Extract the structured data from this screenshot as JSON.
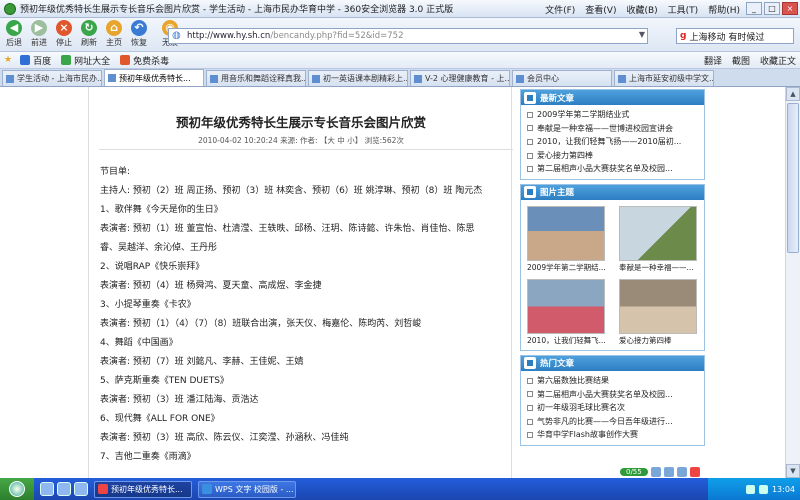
{
  "window": {
    "title": "预初年级优秀特长生展示专长音乐会图片欣赏 - 学生活动 - 上海市民办华育中学 - 360安全浏览器 3.0 正式版",
    "menu": [
      "文件(F)",
      "查看(V)",
      "收藏(B)",
      "工具(T)",
      "帮助(H)"
    ]
  },
  "toolbar": {
    "buttons": [
      {
        "label": "后退",
        "icon": "back-arrow-icon",
        "color": "#3aa64a"
      },
      {
        "label": "前进",
        "icon": "forward-arrow-icon",
        "color": "#9bbf9f"
      },
      {
        "label": "停止",
        "icon": "stop-icon",
        "color": "#e0572b"
      },
      {
        "label": "刷新",
        "icon": "refresh-icon",
        "color": "#3aa64a"
      },
      {
        "label": "主页",
        "icon": "home-icon",
        "color": "#e8a52e"
      },
      {
        "label": "恢复",
        "icon": "restore-icon",
        "color": "#3a7bd5"
      },
      {
        "label": "无痕",
        "icon": "incognito-icon",
        "color": "#e8a52e"
      }
    ],
    "address_host": "http://www.hy.sh.cn",
    "address_path": "/bencandy.php?fid=52&id=752",
    "search_text": "上海移动 有时候过"
  },
  "favbar": {
    "items": [
      {
        "label": "百度",
        "color": "#2f6fd6"
      },
      {
        "label": "网址大全",
        "color": "#3aa64a"
      },
      {
        "label": "免费杀毒",
        "color": "#e0572b"
      }
    ],
    "right": [
      "翻译",
      "截图",
      "收藏正文"
    ]
  },
  "tabs": [
    {
      "label": "学生活动 - 上海市民办...",
      "active": false
    },
    {
      "label": "预初年级优秀特长...",
      "active": true
    },
    {
      "label": "用音乐和舞蹈诠释真我...",
      "active": false
    },
    {
      "label": "初一英语课本剧精彩上...",
      "active": false
    },
    {
      "label": "V-2 心理健康教育 - 上...",
      "active": false
    },
    {
      "label": "会员中心",
      "active": false
    },
    {
      "label": "上海市延安初级中学文...",
      "active": false
    }
  ],
  "article": {
    "title": "预初年级优秀特长生展示专长音乐会图片欣赏",
    "meta": "2010-04-02 10:20:24 来源: 作者: 【大 中 小】 浏览:562次",
    "lines": [
      "节目单:",
      "主持人: 预初（2）班 周正扬、预初（3）班 林奕含、预初（6）班 姚淳琳、预初（8）班 陶元杰",
      "1、歌伴舞《今天是你的生日》",
      "表演者: 预初（1）班 董宣怡、杜清滢、王轶昳、邱杨、汪玥、陈诗懿、许朱怡、肖佳怡、陈思",
      "睿、吴越洋、余沁倬、王丹彤",
      "2、说唱RAP《快乐崇拜》",
      "表演者: 预初（4）班 杨舜鸿、夏天童、高成煜、李金捷",
      "3、小提琴重奏《卡农》",
      "表演者: 预初（1）（4）（7）（8）班联合出演，张天仪、梅嘉伦、陈昀芮、刘哲峻",
      "4、舞蹈《中国画》",
      "表演者: 预初（7）班 刘懿凡、李赫、王佳妮、王婧",
      "5、萨克斯重奏《TEN DUETS》",
      "表演者: 预初（3）班 潘江陆海、贡浩达",
      "6、现代舞《ALL FOR ONE》",
      "表演者: 预初（3）班 高欣、陈云仪、江奕滢、孙涵秋、冯佳纯",
      "7、吉他二重奏《雨滴》"
    ]
  },
  "sidebar": {
    "latest": {
      "header": "最新文章",
      "items": [
        "2009学年第二学期结业式",
        "奉献是一种幸福——世博进校园宣讲会",
        "2010，让我们轻舞飞扬——2010届初...",
        "爱心接力第四棒",
        "第二届相声小品大赛获奖名单及校园..."
      ]
    },
    "pictures": {
      "header": "图片主题",
      "items": [
        {
          "caption": "2009学年第二学期结...",
          "c1": "#6a8fb8",
          "c2": "#c9a889"
        },
        {
          "caption": "奉献是一种幸福——...",
          "c1": "#c8d6e0",
          "c2": "#6c8a4a"
        },
        {
          "caption": "2010，让我们轻舞飞...",
          "c1": "#8aa6c0",
          "c2": "#d15b6a"
        },
        {
          "caption": "爱心接力第四棒",
          "c1": "#9a8a78",
          "c2": "#d6c3ac"
        }
      ]
    },
    "hot": {
      "header": "热门文章",
      "items": [
        "第六届数独比赛结果",
        "第二届相声小品大赛获奖名单及校园...",
        "初一年级羽毛球比赛名次",
        "气势非凡的比赛——今日吾年级进行...",
        "华育中学Flash故事创作大赛"
      ]
    }
  },
  "statusline": {
    "progress": "0/55"
  },
  "taskbar": {
    "tasks": [
      {
        "label": "预初年级优秀特长...",
        "active": true
      },
      {
        "label": "WPS 文字 校园版 - ...",
        "active": false
      }
    ],
    "clock": "13:04"
  }
}
